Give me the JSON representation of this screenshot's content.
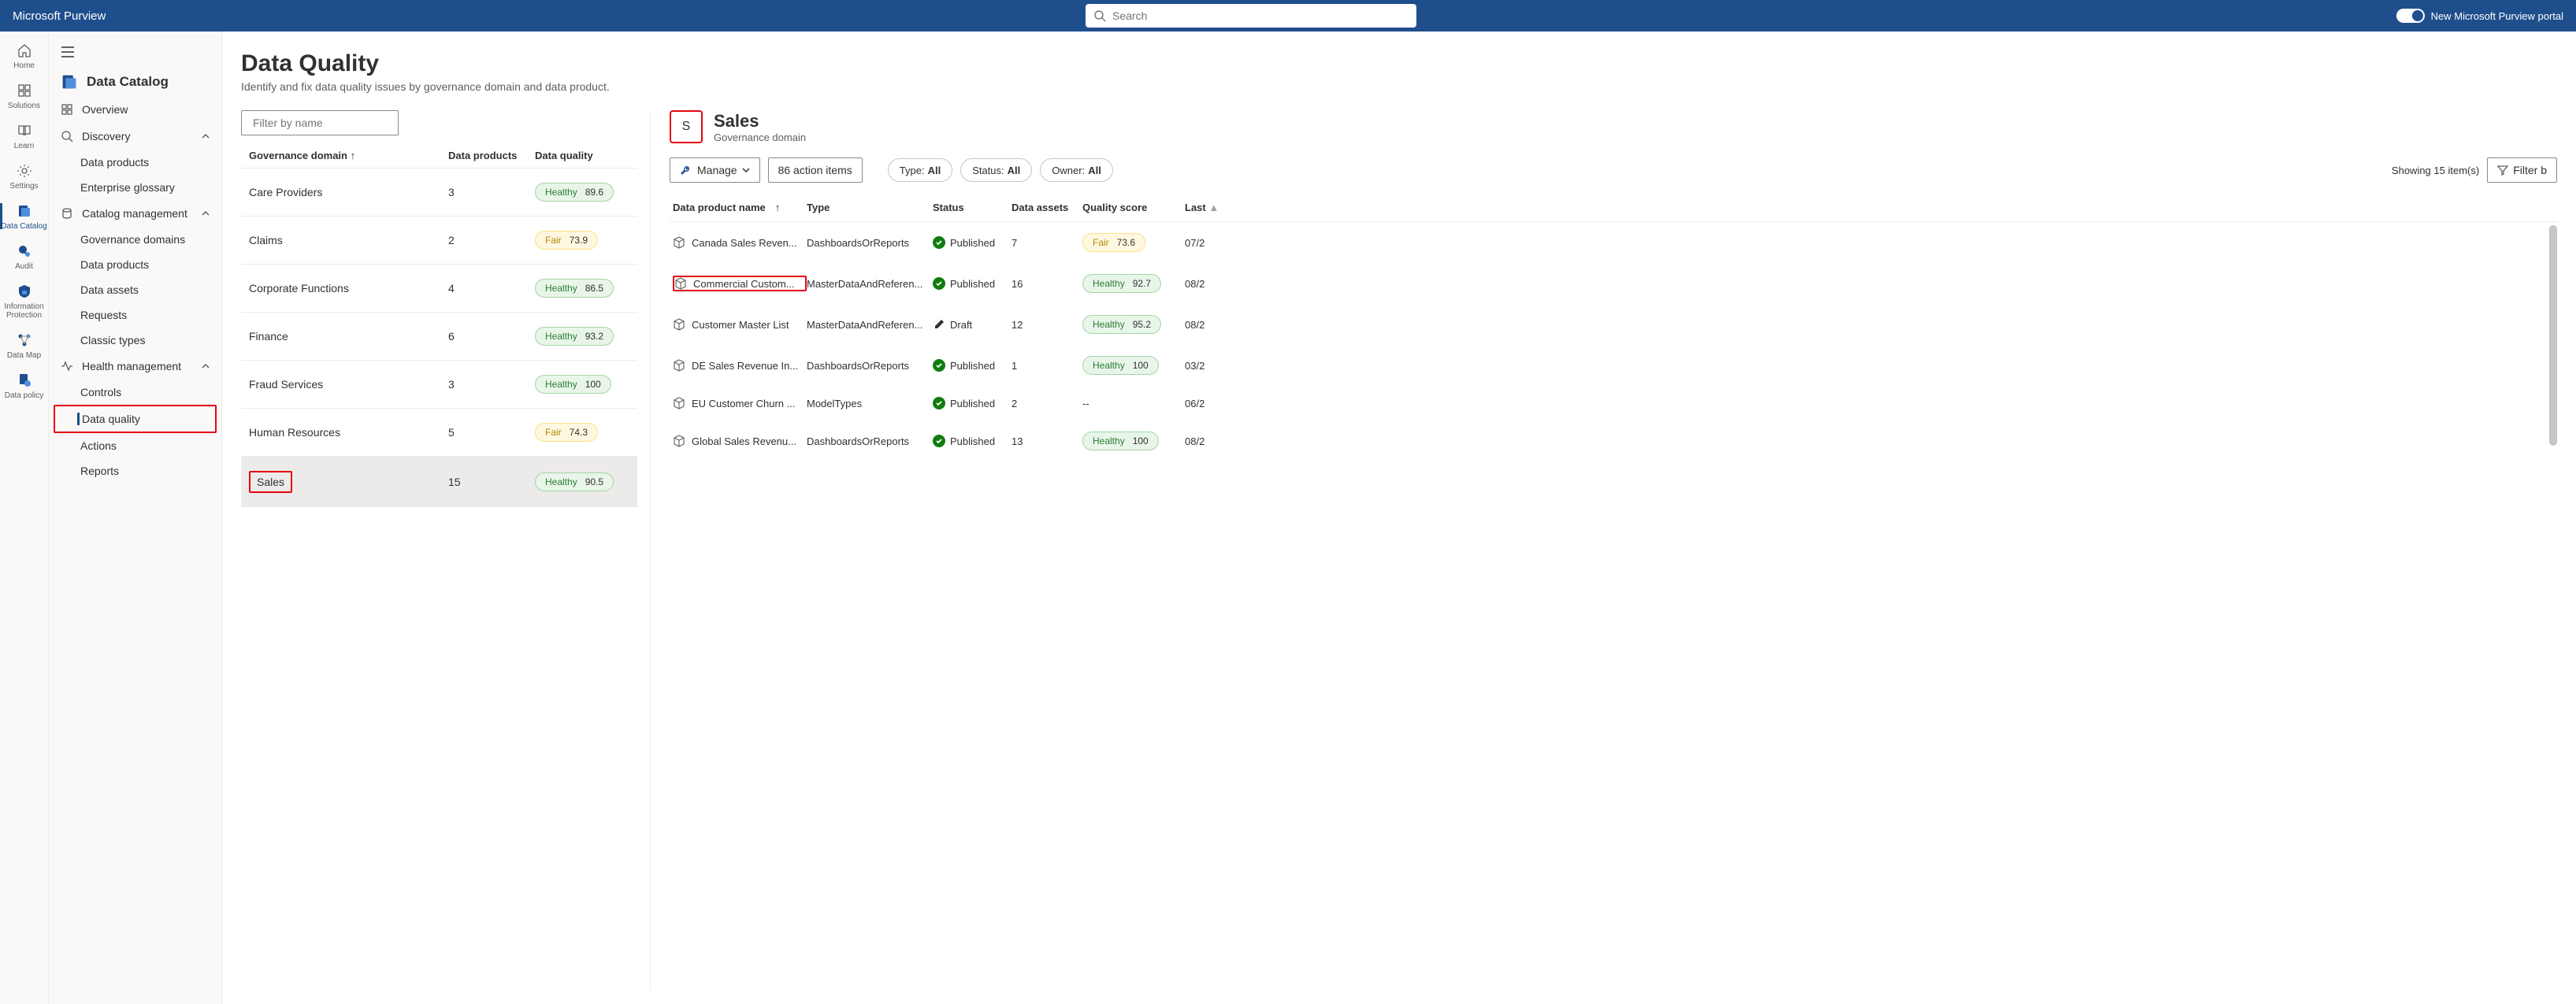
{
  "brand": "Microsoft Purview",
  "search_placeholder": "Search",
  "portal_toggle_label": "New Microsoft Purview portal",
  "rail": [
    {
      "label": "Home"
    },
    {
      "label": "Solutions"
    },
    {
      "label": "Learn"
    },
    {
      "label": "Settings"
    },
    {
      "label": "Data Catalog"
    },
    {
      "label": "Audit"
    },
    {
      "label": "Information Protection"
    },
    {
      "label": "Data Map"
    },
    {
      "label": "Data policy"
    }
  ],
  "side": {
    "title": "Data Catalog",
    "overview": "Overview",
    "discovery": {
      "label": "Discovery",
      "items": [
        "Data products",
        "Enterprise glossary"
      ]
    },
    "catalog": {
      "label": "Catalog management",
      "items": [
        "Governance domains",
        "Data products",
        "Data assets",
        "Requests",
        "Classic types"
      ]
    },
    "health": {
      "label": "Health management",
      "items": [
        "Controls",
        "Data quality",
        "Actions",
        "Reports"
      ]
    }
  },
  "page": {
    "title": "Data Quality",
    "subtitle": "Identify and fix data quality issues by governance domain and data product."
  },
  "filter_placeholder": "Filter by name",
  "dom_cols": {
    "c1": "Governance domain",
    "c2": "Data products",
    "c3": "Data quality"
  },
  "domains": [
    {
      "name": "Care Providers",
      "products": "3",
      "health": "Healthy",
      "score": "89.6"
    },
    {
      "name": "Claims",
      "products": "2",
      "health": "Fair",
      "score": "73.9"
    },
    {
      "name": "Corporate Functions",
      "products": "4",
      "health": "Healthy",
      "score": "86.5"
    },
    {
      "name": "Finance",
      "products": "6",
      "health": "Healthy",
      "score": "93.2"
    },
    {
      "name": "Fraud Services",
      "products": "3",
      "health": "Healthy",
      "score": "100"
    },
    {
      "name": "Human Resources",
      "products": "5",
      "health": "Fair",
      "score": "74.3"
    },
    {
      "name": "Sales",
      "products": "15",
      "health": "Healthy",
      "score": "90.5"
    }
  ],
  "detail": {
    "initial": "S",
    "title": "Sales",
    "subtitle": "Governance domain",
    "manage_label": "Manage",
    "actions_label": "86 action items",
    "pills": {
      "type_k": "Type:",
      "type_v": "All",
      "status_k": "Status:",
      "status_v": "All",
      "owner_k": "Owner:",
      "owner_v": "All"
    },
    "showing": "Showing 15 item(s)",
    "filter_label": "Filter b",
    "cols": {
      "name": "Data product name",
      "type": "Type",
      "status": "Status",
      "assets": "Data assets",
      "score": "Quality score",
      "last": "Last"
    },
    "rows": [
      {
        "name": "Canada Sales Reven...",
        "type": "DashboardsOrReports",
        "status": "Published",
        "assets": "7",
        "health": "Fair",
        "score": "73.6",
        "last": "07/2"
      },
      {
        "name": "Commercial Custom...",
        "type": "MasterDataAndReferen...",
        "status": "Published",
        "assets": "16",
        "health": "Healthy",
        "score": "92.7",
        "last": "08/2"
      },
      {
        "name": "Customer Master List",
        "type": "MasterDataAndReferen...",
        "status": "Draft",
        "assets": "12",
        "health": "Healthy",
        "score": "95.2",
        "last": "08/2"
      },
      {
        "name": "DE Sales Revenue In...",
        "type": "DashboardsOrReports",
        "status": "Published",
        "assets": "1",
        "health": "Healthy",
        "score": "100",
        "last": "03/2"
      },
      {
        "name": "EU Customer Churn ...",
        "type": "ModelTypes",
        "status": "Published",
        "assets": "2",
        "health": "",
        "score": "--",
        "last": "06/2"
      },
      {
        "name": "Global Sales Revenu...",
        "type": "DashboardsOrReports",
        "status": "Published",
        "assets": "13",
        "health": "Healthy",
        "score": "100",
        "last": "08/2"
      }
    ]
  }
}
